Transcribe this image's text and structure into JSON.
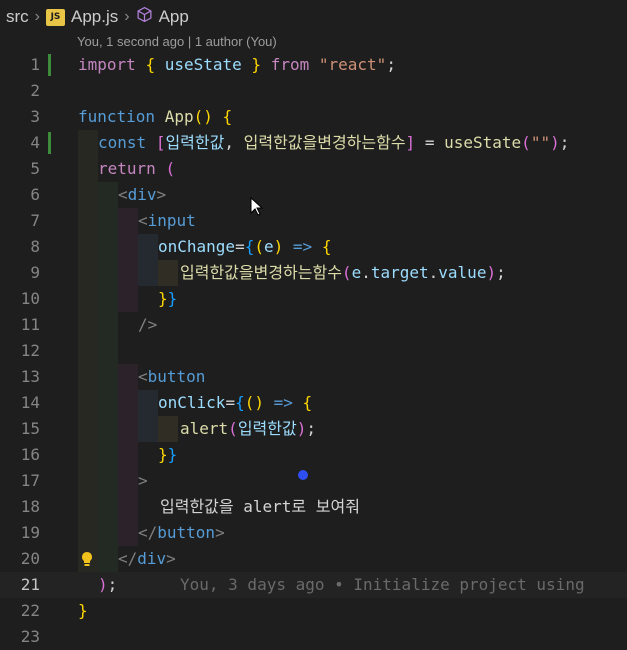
{
  "breadcrumb": {
    "folder": "src",
    "file_icon": "JS",
    "file": "App.js",
    "symbol_icon": "cube-icon",
    "symbol": "App"
  },
  "blame_header": "You, 1 second ago | 1 author (You)",
  "editor": {
    "current_line": 21,
    "inline_blame": "You, 3 days ago • Initialize project using",
    "lines": [
      {
        "n": "1"
      },
      {
        "n": "2"
      },
      {
        "n": "3"
      },
      {
        "n": "4"
      },
      {
        "n": "5"
      },
      {
        "n": "6"
      },
      {
        "n": "7"
      },
      {
        "n": "8"
      },
      {
        "n": "9"
      },
      {
        "n": "10"
      },
      {
        "n": "11"
      },
      {
        "n": "12"
      },
      {
        "n": "13"
      },
      {
        "n": "14"
      },
      {
        "n": "15"
      },
      {
        "n": "16"
      },
      {
        "n": "17"
      },
      {
        "n": "18"
      },
      {
        "n": "19"
      },
      {
        "n": "20"
      },
      {
        "n": "21"
      },
      {
        "n": "22"
      },
      {
        "n": "23"
      }
    ],
    "code": {
      "l1": [
        "import",
        "{",
        "useState",
        "}",
        "from",
        "\"react\"",
        ";"
      ],
      "l3": [
        "function",
        "App",
        "(",
        ")",
        "{"
      ],
      "l4": [
        "const",
        "[",
        "입력한값",
        ",",
        "입력한값을변경하는함수",
        "]",
        "=",
        "useState",
        "(",
        "\"\"",
        ")",
        ";"
      ],
      "l5": [
        "return",
        "("
      ],
      "l6": [
        "<",
        "div",
        ">"
      ],
      "l7": [
        "<",
        "input"
      ],
      "l8": [
        "onChange",
        "=",
        "{",
        "(",
        "e",
        ")",
        "=>",
        "{"
      ],
      "l9": [
        "입력한값을변경하는함수",
        "(",
        "e",
        ".",
        "target",
        ".",
        "value",
        ")",
        ";"
      ],
      "l10": [
        "}",
        "}"
      ],
      "l11": [
        "/>"
      ],
      "l13": [
        "<",
        "button"
      ],
      "l14": [
        "onClick",
        "=",
        "{",
        "(",
        ")",
        "=>",
        "{"
      ],
      "l15": [
        "alert",
        "(",
        "입력한값",
        ")",
        ";"
      ],
      "l16": [
        "}",
        "}"
      ],
      "l17": [
        ">"
      ],
      "l18": [
        "입력한값을 alert로 보여줘"
      ],
      "l19": [
        "</",
        "button",
        ">"
      ],
      "l20": [
        "</",
        "div",
        ">"
      ],
      "l21": [
        ")",
        ";"
      ],
      "l22": [
        "}"
      ]
    }
  },
  "colors": {
    "background": "#1e1e1e",
    "keyword": "#569cd6",
    "control": "#c586c0",
    "function": "#dcdcaa",
    "variable": "#9cdcfe",
    "string": "#ce9178",
    "bracket_gold": "#ffd700",
    "bracket_purple": "#da70d6",
    "bracket_blue": "#179fff",
    "git_added": "#3c8c3c"
  }
}
